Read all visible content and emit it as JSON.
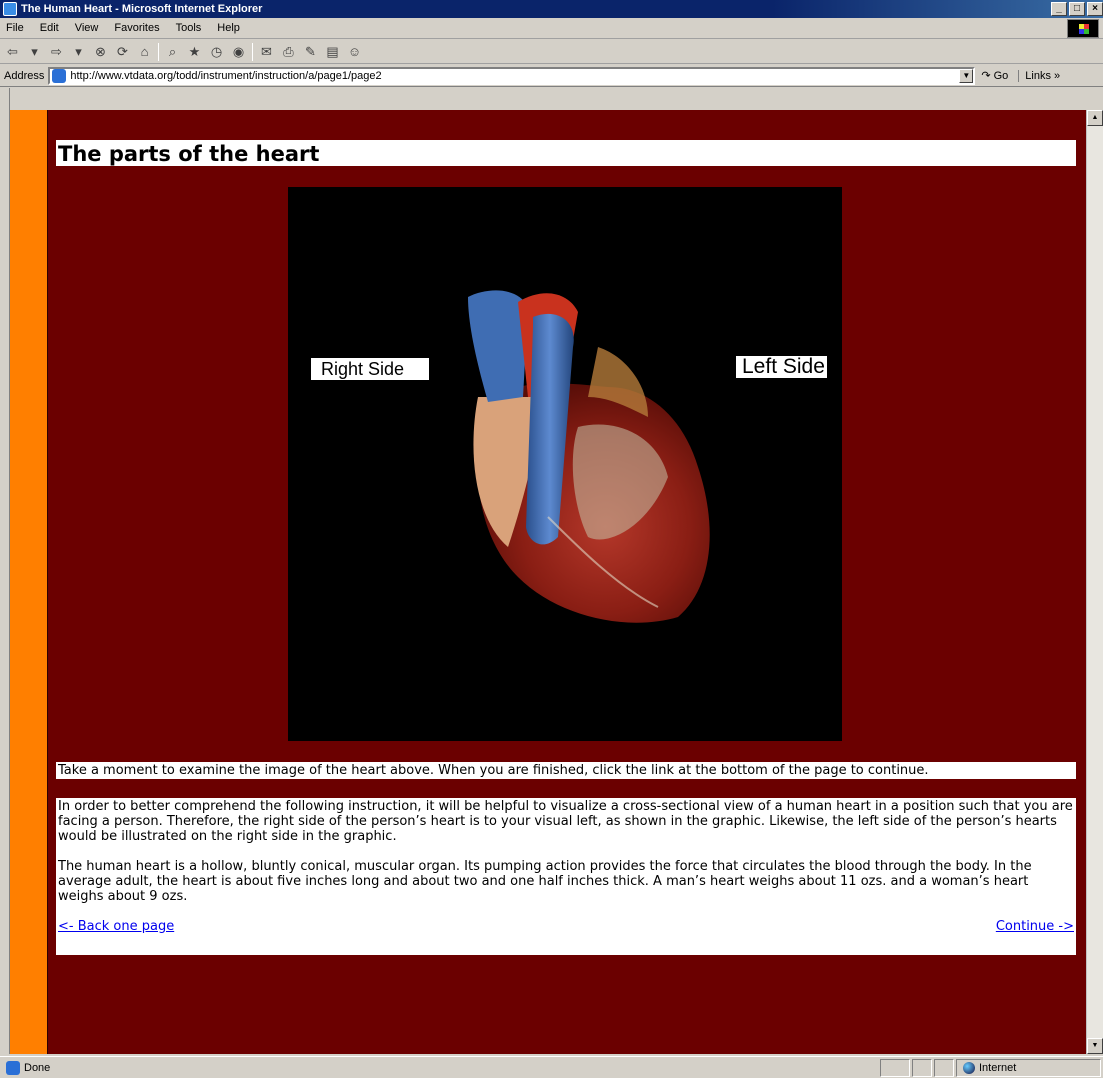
{
  "window": {
    "title": "The Human Heart - Microsoft Internet Explorer",
    "controls": [
      "_",
      "□",
      "×"
    ]
  },
  "menu": [
    "File",
    "Edit",
    "View",
    "Favorites",
    "Tools",
    "Help"
  ],
  "toolbar": {
    "icons": [
      "back-icon",
      "forward-icon",
      "stop-icon",
      "refresh-icon",
      "home-icon",
      "search-icon",
      "favorites-icon",
      "history-icon",
      "mail-icon",
      "print-icon",
      "edit-icon",
      "discuss-icon",
      "messenger-icon"
    ]
  },
  "address": {
    "label": "Address",
    "url": "http://www.vtdata.org/todd/instrument/instruction/a/page1/page2",
    "go_label": "Go",
    "links_label": "Links »"
  },
  "page": {
    "heading": "The parts of the heart",
    "image_labels": {
      "right_side": "Right Side",
      "left_side": "Left Side"
    },
    "instruction": "Take a moment to examine the image of the heart above. When you are finished, click the link at the bottom of the page to continue.",
    "paragraph1": "In order to better comprehend the following instruction, it will be helpful to visualize a cross-sectional view of a human heart in a position such that you are facing a person. Therefore, the right side of the person’s heart is to your visual left, as shown in the graphic. Likewise, the left side of the person’s hearts would be illustrated on the right side in the graphic.",
    "paragraph2": "The human heart is a hollow, bluntly conical, muscular organ. Its pumping action provides the force that circulates the blood through the body. In the average adult, the heart is about five inches long and about two and one half inches thick. A man’s heart weighs about 11 ozs. and a woman’s heart weighs about 9 ozs.",
    "back_link": "<- Back one page",
    "continue_link": "Continue ->"
  },
  "status": {
    "text": "Done",
    "zone": "Internet"
  },
  "colors": {
    "page_background": "#6b0000",
    "side_bar": "#ff7f00",
    "link": "#0000ee"
  }
}
